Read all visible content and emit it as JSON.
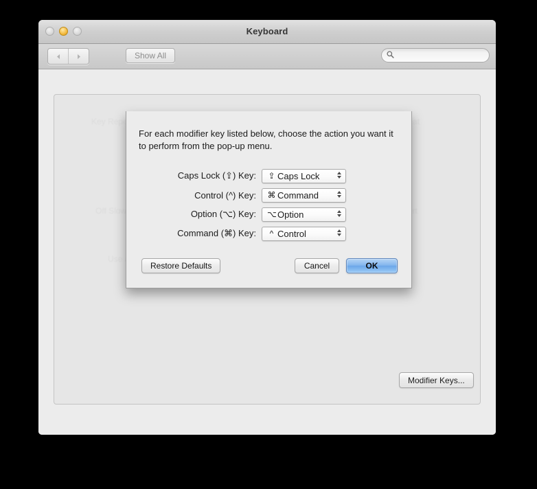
{
  "window": {
    "title": "Keyboard",
    "traffic_lights": [
      {
        "name": "close",
        "state": "disabled"
      },
      {
        "name": "minimize",
        "state": "enabled"
      },
      {
        "name": "zoom",
        "state": "disabled"
      }
    ]
  },
  "toolbar": {
    "back_icon": "chevron-left-icon",
    "forward_icon": "chevron-right-icon",
    "show_all_label": "Show All",
    "search": {
      "icon": "search-icon",
      "value": "",
      "placeholder": ""
    }
  },
  "pane": {
    "modifier_keys_button": "Modifier Keys...",
    "help_button": "?"
  },
  "sheet": {
    "description": "For each modifier key listed below, choose the action you want it to perform from the pop-up menu.",
    "rows": [
      {
        "label": "Caps Lock (⇪) Key:",
        "value_symbol": "⇪",
        "value_label": "Caps Lock"
      },
      {
        "label": "Control (^) Key:",
        "value_symbol": "⌘",
        "value_label": "Command"
      },
      {
        "label": "Option (⌥) Key:",
        "value_symbol": "⌥",
        "value_label": "Option"
      },
      {
        "label": "Command (⌘) Key:",
        "value_symbol": "^",
        "value_label": "Control"
      }
    ],
    "buttons": {
      "restore": "Restore Defaults",
      "cancel": "Cancel",
      "ok": "OK"
    }
  },
  "colors": {
    "default_button_blue": "#84b6ee",
    "window_chrome": "#ececec",
    "minimize_yellow": "#f4bb42"
  }
}
